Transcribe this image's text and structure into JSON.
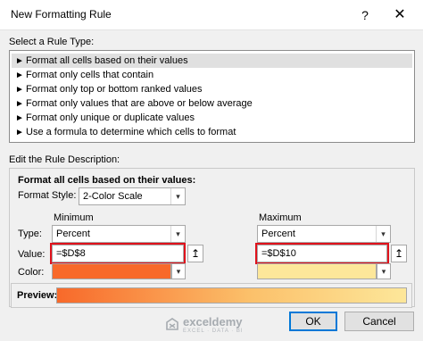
{
  "window": {
    "title": "New Formatting Rule",
    "help_glyph": "?",
    "close_glyph": "✕"
  },
  "rule_type": {
    "section_label": "Select a Rule Type:",
    "items": [
      {
        "label": "Format all cells based on their values",
        "selected": true
      },
      {
        "label": "Format only cells that contain",
        "selected": false
      },
      {
        "label": "Format only top or bottom ranked values",
        "selected": false
      },
      {
        "label": "Format only values that are above or below average",
        "selected": false
      },
      {
        "label": "Format only unique or duplicate values",
        "selected": false
      },
      {
        "label": "Use a formula to determine which cells to format",
        "selected": false
      }
    ],
    "item_marker": "►"
  },
  "description": {
    "section_label": "Edit the Rule Description:",
    "heading": "Format all cells based on their values:",
    "format_style_label": "Format Style:",
    "format_style_value": "2-Color Scale",
    "minimum_label": "Minimum",
    "maximum_label": "Maximum",
    "type_label": "Type:",
    "value_label": "Value:",
    "color_label": "Color:",
    "min_type": "Percent",
    "max_type": "Percent",
    "min_value": "=$D$8",
    "max_value": "=$D$10",
    "min_color": "#f8692a",
    "max_color": "#fde79a",
    "preview_label": "Preview:",
    "highlight_color": "#e0121c",
    "collapse_icon": "↥",
    "chevron": "▾"
  },
  "buttons": {
    "ok": "OK",
    "cancel": "Cancel"
  },
  "watermark": {
    "name": "exceldemy",
    "tagline": "EXCEL · DATA · BI"
  }
}
